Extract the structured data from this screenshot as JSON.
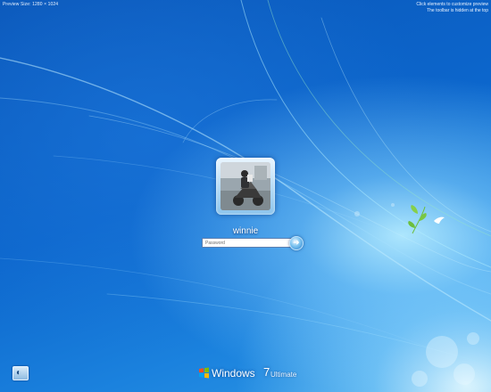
{
  "preview": {
    "size_label": "Preview Size: 1280 × 1024",
    "hint_line1": "Click elements to customize preview",
    "hint_line2": "The toolbar is hidden at the top"
  },
  "login": {
    "username": "winnie",
    "password_placeholder": "Password",
    "password_value": "",
    "submit_icon": "arrow-right-icon"
  },
  "ease_of_access": {
    "icon": "ease-of-access-icon"
  },
  "branding": {
    "name": "Windows",
    "version": "7",
    "edition": "Ultimate",
    "logo_icon": "windows-flag-icon"
  },
  "colors": {
    "background_primary": "#0c66cc",
    "background_highlight": "#b4ebff",
    "text": "#ffffff"
  }
}
